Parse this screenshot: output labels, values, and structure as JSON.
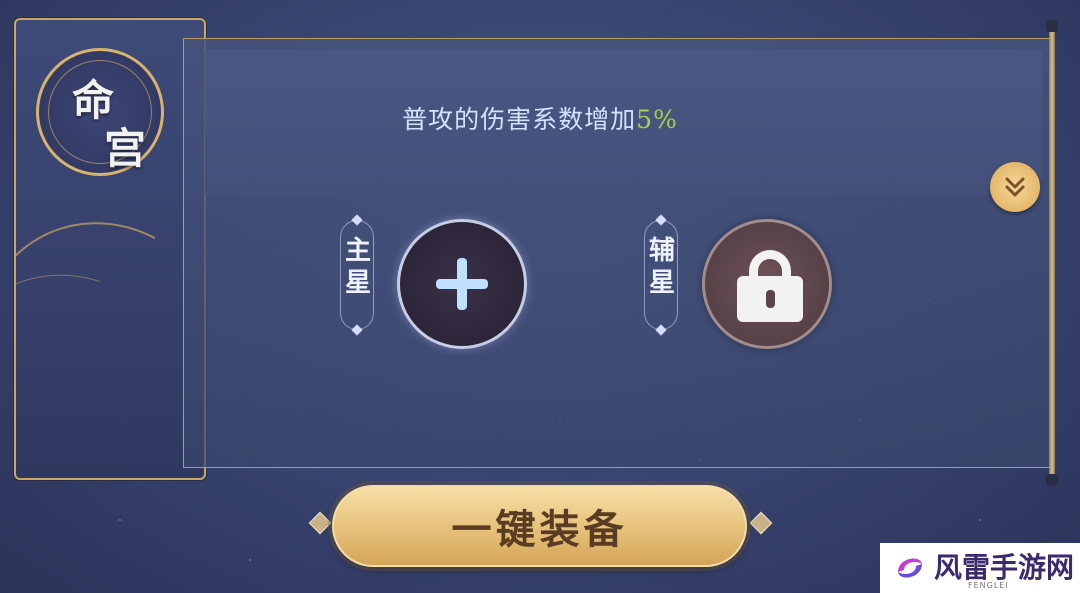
{
  "banner": {
    "title_chars": [
      "命",
      "宫"
    ]
  },
  "bonus": {
    "text": "普攻的伤害系数增加",
    "value": "5%"
  },
  "slots": {
    "main": {
      "label": "主星",
      "state": "empty",
      "icon": "plus-icon"
    },
    "sub": {
      "label": "辅星",
      "state": "locked",
      "icon": "lock-icon"
    }
  },
  "expand_icon": "double-chevron-down-icon",
  "equip_button": {
    "label": "一键装备"
  },
  "watermark": {
    "text": "风雷手游网",
    "subtext": "FENGLEI"
  },
  "colors": {
    "accent_gold": "#e4b76a",
    "bonus_green": "#9fd44a",
    "panel_bg": "#44507a"
  }
}
